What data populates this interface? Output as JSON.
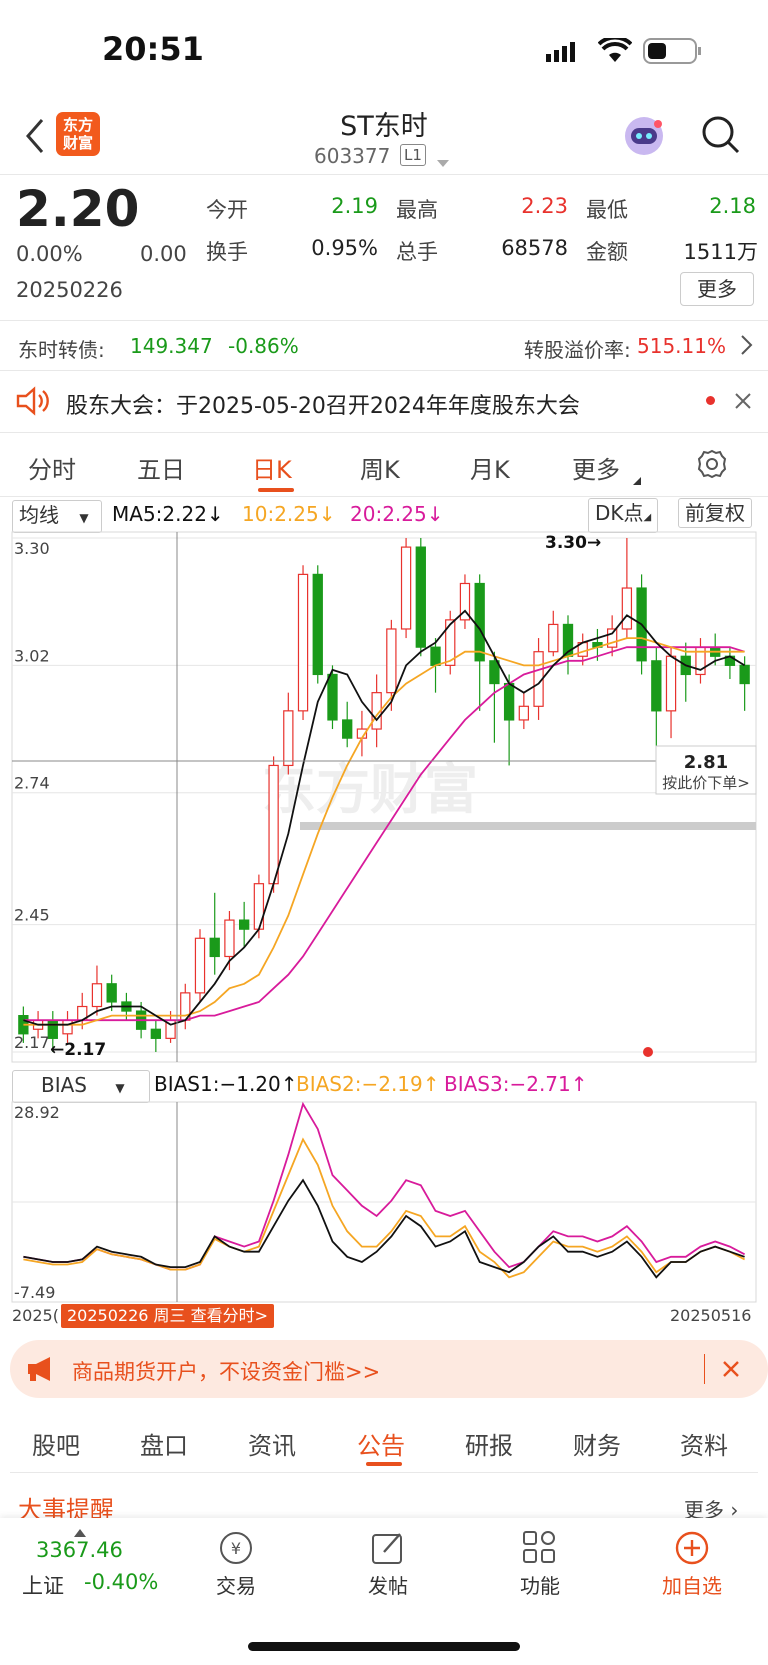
{
  "status": {
    "time": "20:51"
  },
  "header": {
    "title": "ST东时",
    "code": "603377",
    "level": "L1",
    "logo_line1": "东方",
    "logo_line2": "财富"
  },
  "quote": {
    "price": "2.20",
    "change_pct": "0.00%",
    "change": "0.00",
    "date": "20250226",
    "open_label": "今开",
    "open": "2.19",
    "high_label": "最高",
    "high": "2.23",
    "low_label": "最低",
    "low": "2.18",
    "turnover_label": "换手",
    "turnover": "0.95%",
    "volume_label": "总手",
    "volume": "68578",
    "amount_label": "金额",
    "amount": "1511万",
    "more": "更多"
  },
  "bond": {
    "label": "东时转债:",
    "price": "149.347",
    "change": "-0.86%",
    "premium_label": "转股溢价率:",
    "premium": "515.11%"
  },
  "notice": {
    "text": "股东大会：于2025-05-20召开2024年年度股东大会"
  },
  "chart_tabs": [
    "分时",
    "五日",
    "日K",
    "周K",
    "月K",
    "更多"
  ],
  "chart_tab_active": 2,
  "kline": {
    "ma_selector": "均线",
    "ma5": "MA5:2.22↓",
    "ma10": "10:2.25↓",
    "ma20": "20:2.25↓",
    "dk": "DK点",
    "adjust": "前复权",
    "y_ticks": [
      "3.30",
      "3.02",
      "2.74",
      "2.45",
      "2.17"
    ],
    "max_label": "3.30→",
    "min_label": "←2.17",
    "cursor_price": "2.81",
    "cursor_hint": "按此价下单>",
    "watermark": "东方财富"
  },
  "bias": {
    "selector": "BIAS",
    "bias1": "BIAS1:−1.20↑",
    "bias2": "BIAS2:−2.19↑",
    "bias3": "BIAS3:−2.71↑",
    "y_top": "28.92",
    "y_bottom": "-7.49",
    "start_date": "2025(",
    "end_date": "20250516",
    "cursor_tag": "20250226 周三 查看分时>"
  },
  "promo": {
    "text": "商品期货开户，不设资金门槛>>"
  },
  "section_tabs": [
    "股吧",
    "盘口",
    "资讯",
    "公告",
    "研报",
    "财务",
    "资料"
  ],
  "section_tab_active": 3,
  "events": {
    "title": "大事提醒",
    "more": "更多"
  },
  "bottom": {
    "index_value": "3367.46",
    "index_name": "上证",
    "index_change": "-0.40%",
    "items": [
      "交易",
      "发帖",
      "功能",
      "加自选"
    ]
  },
  "colors": {
    "up": "#e8322d",
    "down": "#1a9a1a",
    "accent": "#e8501d",
    "ma5": "#111111",
    "ma10": "#f5a623",
    "ma20": "#d81b9b"
  },
  "chart_data": {
    "type": "candlestick",
    "y_range": [
      2.17,
      3.3
    ],
    "candles": [
      [
        2.25,
        2.21,
        2.27,
        2.19
      ],
      [
        2.22,
        2.24,
        2.26,
        2.2
      ],
      [
        2.24,
        2.2,
        2.26,
        2.17
      ],
      [
        2.21,
        2.24,
        2.26,
        2.19
      ],
      [
        2.24,
        2.27,
        2.3,
        2.22
      ],
      [
        2.27,
        2.32,
        2.36,
        2.25
      ],
      [
        2.32,
        2.28,
        2.34,
        2.26
      ],
      [
        2.28,
        2.26,
        2.3,
        2.24
      ],
      [
        2.26,
        2.22,
        2.28,
        2.2
      ],
      [
        2.22,
        2.2,
        2.24,
        2.17
      ],
      [
        2.2,
        2.24,
        2.26,
        2.19
      ],
      [
        2.24,
        2.3,
        2.32,
        2.22
      ],
      [
        2.3,
        2.42,
        2.44,
        2.28
      ],
      [
        2.42,
        2.38,
        2.52,
        2.34
      ],
      [
        2.38,
        2.46,
        2.48,
        2.35
      ],
      [
        2.46,
        2.44,
        2.5,
        2.4
      ],
      [
        2.44,
        2.54,
        2.56,
        2.42
      ],
      [
        2.54,
        2.8,
        2.82,
        2.52
      ],
      [
        2.8,
        2.92,
        2.96,
        2.78
      ],
      [
        2.92,
        3.22,
        3.24,
        2.9
      ],
      [
        3.22,
        3.0,
        3.24,
        2.98
      ],
      [
        3.0,
        2.9,
        3.02,
        2.88
      ],
      [
        2.9,
        2.86,
        2.94,
        2.84
      ],
      [
        2.86,
        2.88,
        2.92,
        2.82
      ],
      [
        2.88,
        2.96,
        3.0,
        2.84
      ],
      [
        2.96,
        3.1,
        3.12,
        2.92
      ],
      [
        3.1,
        3.28,
        3.3,
        3.08
      ],
      [
        3.28,
        3.06,
        3.3,
        3.04
      ],
      [
        3.06,
        3.02,
        3.08,
        2.96
      ],
      [
        3.02,
        3.12,
        3.14,
        3.0
      ],
      [
        3.12,
        3.2,
        3.22,
        3.1
      ],
      [
        3.2,
        3.03,
        3.22,
        2.92
      ],
      [
        3.03,
        2.98,
        3.05,
        2.85
      ],
      [
        2.98,
        2.9,
        3.0,
        2.8
      ],
      [
        2.9,
        2.93,
        2.96,
        2.88
      ],
      [
        2.93,
        3.05,
        3.08,
        2.9
      ],
      [
        3.05,
        3.11,
        3.14,
        3.04
      ],
      [
        3.11,
        3.04,
        3.13,
        3.0
      ],
      [
        3.04,
        3.07,
        3.09,
        3.02
      ],
      [
        3.07,
        3.06,
        3.1,
        3.03
      ],
      [
        3.06,
        3.1,
        3.13,
        3.04
      ],
      [
        3.1,
        3.19,
        3.3,
        3.08
      ],
      [
        3.19,
        3.03,
        3.22,
        3.0
      ],
      [
        3.03,
        2.92,
        3.06,
        2.8
      ],
      [
        2.92,
        3.04,
        3.06,
        2.86
      ],
      [
        3.04,
        3.0,
        3.07,
        2.94
      ],
      [
        3.0,
        3.06,
        3.08,
        2.98
      ],
      [
        3.06,
        3.04,
        3.09,
        3.02
      ],
      [
        3.04,
        3.02,
        3.06,
        2.99
      ],
      [
        3.02,
        2.98,
        3.04,
        2.92
      ]
    ],
    "ma5": [
      2.24,
      2.23,
      2.23,
      2.23,
      2.24,
      2.26,
      2.27,
      2.27,
      2.27,
      2.25,
      2.23,
      2.24,
      2.28,
      2.32,
      2.37,
      2.4,
      2.44,
      2.54,
      2.65,
      2.8,
      2.94,
      3.01,
      3.0,
      2.94,
      2.9,
      2.94,
      3.02,
      3.05,
      3.07,
      3.11,
      3.14,
      3.1,
      3.04,
      2.98,
      2.96,
      2.98,
      3.02,
      3.05,
      3.07,
      3.08,
      3.09,
      3.13,
      3.11,
      3.07,
      3.04,
      3.02,
      3.01,
      3.03,
      3.04,
      3.02
    ],
    "ma10": [
      2.23,
      2.23,
      2.23,
      2.23,
      2.23,
      2.24,
      2.25,
      2.25,
      2.25,
      2.25,
      2.25,
      2.25,
      2.26,
      2.28,
      2.31,
      2.32,
      2.34,
      2.4,
      2.47,
      2.56,
      2.65,
      2.73,
      2.8,
      2.86,
      2.91,
      2.95,
      2.98,
      3.0,
      3.02,
      3.03,
      3.05,
      3.05,
      3.04,
      3.03,
      3.02,
      3.02,
      3.03,
      3.04,
      3.05,
      3.06,
      3.07,
      3.08,
      3.08,
      3.07,
      3.06,
      3.05,
      3.05,
      3.05,
      3.05,
      3.05
    ],
    "ma20": [
      2.24,
      2.24,
      2.24,
      2.24,
      2.24,
      2.24,
      2.24,
      2.24,
      2.24,
      2.24,
      2.24,
      2.24,
      2.25,
      2.25,
      2.26,
      2.27,
      2.28,
      2.31,
      2.34,
      2.38,
      2.43,
      2.48,
      2.53,
      2.58,
      2.63,
      2.68,
      2.73,
      2.78,
      2.82,
      2.86,
      2.9,
      2.93,
      2.96,
      2.98,
      3.0,
      3.01,
      3.02,
      3.03,
      3.03,
      3.04,
      3.05,
      3.06,
      3.06,
      3.06,
      3.06,
      3.06,
      3.06,
      3.06,
      3.06,
      3.05
    ],
    "bias_range": [
      -7.49,
      28.92
    ],
    "bias1": [
      -1,
      -1.5,
      -2,
      -2,
      -1.5,
      1,
      0,
      -0.5,
      -1,
      -2.5,
      -3,
      -3,
      -2,
      3,
      1,
      0,
      0,
      5,
      10,
      14,
      9,
      2,
      -1,
      -2,
      0,
      3,
      7,
      5,
      1,
      2,
      4,
      -2,
      -3,
      -4,
      -2,
      1,
      3,
      0,
      0,
      -1,
      0,
      2,
      -1,
      -5,
      -2,
      -2,
      0,
      1,
      0,
      -1
    ],
    "bias2": [
      -1.5,
      -2,
      -2.5,
      -2.5,
      -2,
      0.5,
      -0.5,
      -1,
      -1.5,
      -2.5,
      -3.5,
      -3.5,
      -2.5,
      2.5,
      1,
      0,
      1,
      8,
      15,
      22,
      17,
      9,
      4,
      1,
      1,
      4,
      8,
      7,
      3,
      3,
      5,
      0,
      -2,
      -5,
      -4,
      -1,
      2,
      1,
      1,
      0,
      1,
      3,
      0,
      -4,
      -2,
      -2,
      0,
      1,
      0,
      -1.5
    ],
    "bias3": [
      -1,
      -1.5,
      -2,
      -2,
      -1.5,
      0.5,
      -0.5,
      -1,
      -1.5,
      -2.5,
      -3.5,
      -3.5,
      -2.5,
      3,
      2,
      1,
      2,
      10,
      19,
      28.92,
      24,
      15,
      12,
      9,
      7,
      10,
      14,
      13,
      8,
      7,
      8,
      4,
      0,
      -3,
      -2,
      1,
      4,
      3,
      3,
      2,
      3,
      5,
      2,
      -2,
      -1,
      -1,
      1,
      2,
      1,
      -0.5
    ]
  }
}
